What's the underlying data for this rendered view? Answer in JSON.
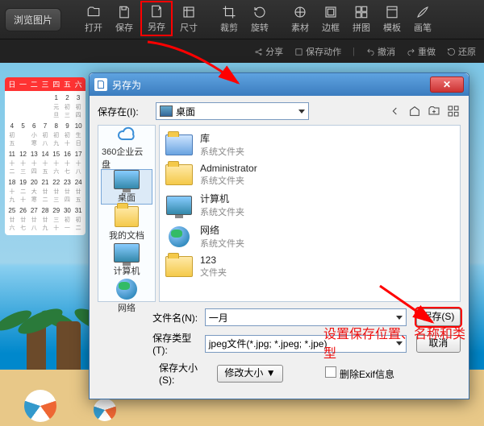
{
  "toolbar": {
    "browse": "浏览图片",
    "open": "打开",
    "save": "保存",
    "saveas": "另存",
    "size": "尺寸",
    "crop": "裁剪",
    "rotate": "旋转",
    "material": "素材",
    "border": "边框",
    "puzzle": "拼图",
    "template": "模板",
    "brush": "画笔"
  },
  "subbar": {
    "share": "分享",
    "save_action": "保存动作",
    "undo": "撤消",
    "redo": "重做",
    "restore": "还原"
  },
  "calendar": {
    "head": "日 一 二 三 四 五 六",
    "cells": [
      "",
      "",
      "",
      "",
      "1",
      "2",
      "3",
      "4",
      "5",
      "6",
      "7",
      "8",
      "9",
      "10",
      "11",
      "12",
      "13",
      "14",
      "15",
      "16",
      "17",
      "18",
      "19",
      "20",
      "21",
      "22",
      "23",
      "24",
      "25",
      "26",
      "27",
      "28",
      "29",
      "30",
      "31"
    ],
    "lunar": [
      "",
      "",
      "",
      "",
      "元旦",
      "初三",
      "初四",
      "初五",
      "",
      "小寒",
      "初八",
      "初九",
      "初十",
      "生日",
      "十二",
      "十三",
      "十四",
      "十五",
      "十六",
      "十七",
      "十八",
      "十九",
      "二十",
      "大寒",
      "廿二",
      "廿三",
      "廿四",
      "廿五",
      "廿六",
      "廿七",
      "廿八",
      "廿九",
      "三十",
      "初一",
      "初二"
    ]
  },
  "dialog": {
    "title": "另存为",
    "save_in_label": "保存在(I):",
    "save_in_value": "桌面",
    "places": {
      "cloud": "360企业云盘",
      "desktop": "桌面",
      "docs": "我的文档",
      "computer": "计算机",
      "network": "网络"
    },
    "files": [
      {
        "name": "库",
        "type": "系统文件夹",
        "icon": "lib"
      },
      {
        "name": "Administrator",
        "type": "系统文件夹",
        "icon": "folder"
      },
      {
        "name": "计算机",
        "type": "系统文件夹",
        "icon": "computer"
      },
      {
        "name": "网络",
        "type": "系统文件夹",
        "icon": "network"
      },
      {
        "name": "123",
        "type": "文件夹",
        "icon": "folder"
      }
    ],
    "filename_label": "文件名(N):",
    "filename_value": "一月",
    "filetype_label": "保存类型(T):",
    "filetype_value": "jpeg文件(*.jpg; *.jpeg; *.jpe)",
    "filesize_label": "保存大小(S):",
    "filesize_btn": "修改大小 ▼",
    "exif_label": "删除Exif信息",
    "save_btn": "保存(S)",
    "cancel_btn": "取消"
  },
  "annotation": "设置保存位置、名称和类型"
}
